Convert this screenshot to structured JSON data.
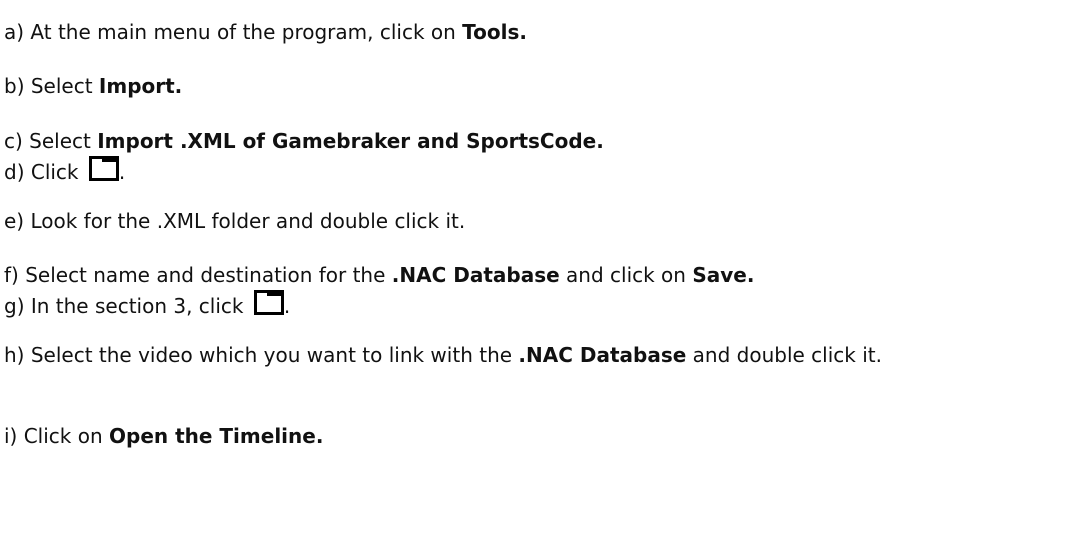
{
  "steps": {
    "a": {
      "prefix": "a) At the main menu of the program, click on ",
      "bold": "Tools."
    },
    "b": {
      "prefix": "b) Select ",
      "bold": "Import."
    },
    "c": {
      "prefix": "c) Select ",
      "bold": "Import .XML of Gamebraker and SportsCode."
    },
    "d": {
      "prefix": "d) Click ",
      "suffix": ".",
      "icon": "folder-icon"
    },
    "e": {
      "text": "e) Look for the .XML folder and double click it."
    },
    "f": {
      "prefix": "f) Select name and destination for the ",
      "bold1": ".NAC Database",
      "middle": " and click on ",
      "bold2": "Save."
    },
    "g": {
      "prefix": "g) In the section 3, click ",
      "suffix": ".",
      "icon": "folder-icon"
    },
    "h": {
      "prefix": "h) Select the video which you want to link with the ",
      "bold": ".NAC Database",
      "suffix": " and double click it."
    },
    "i": {
      "prefix": "i) Click on ",
      "bold": "Open the Timeline."
    }
  }
}
